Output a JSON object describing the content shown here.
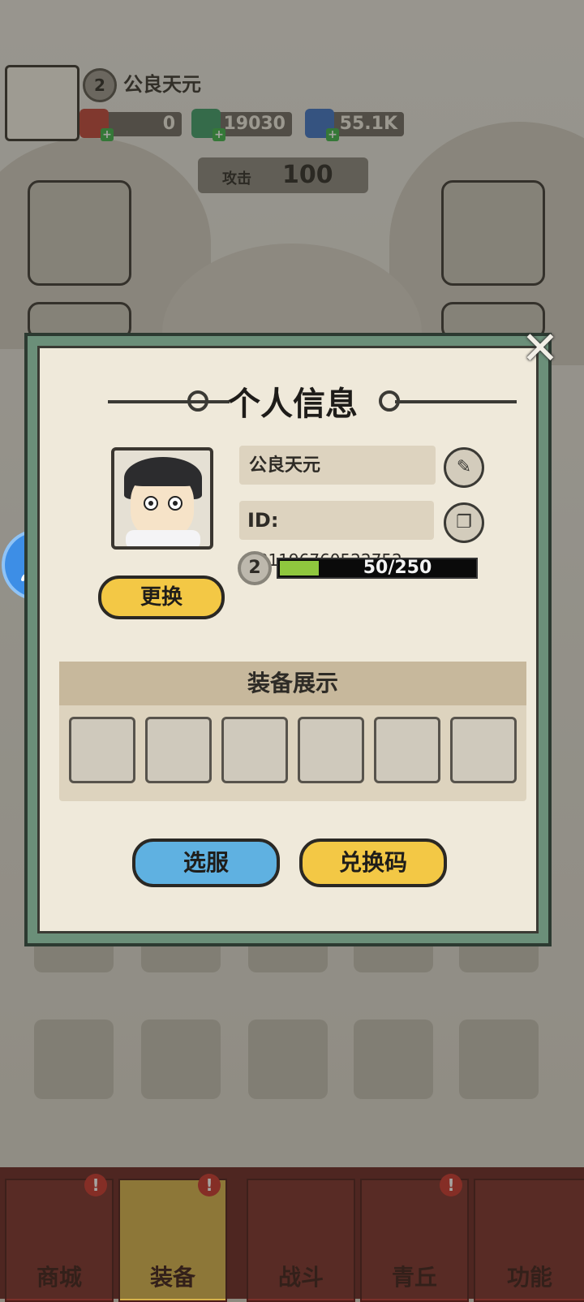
{
  "hud": {
    "player_name": "公良天元",
    "level": "2",
    "resources": [
      {
        "name": "red-gift",
        "value": "0",
        "color": "#c0463a"
      },
      {
        "name": "jade-dragon",
        "value": "19030",
        "color": "#3e9e6a"
      },
      {
        "name": "blue-crystal",
        "value": "55.1K",
        "color": "#3f74c6"
      }
    ],
    "attack_label": "攻击",
    "attack_value": "100"
  },
  "dialog": {
    "title": "个人信息",
    "name": "公良天元",
    "id_label": "ID:",
    "id_value": "381196760522752",
    "level": "2",
    "exp_text": "50/250",
    "exp_progress": 0.2,
    "change_button": "更换",
    "equip_title": "装备展示",
    "equip_slots": 6,
    "server_button": "选服",
    "code_button": "兑换码",
    "close_glyph": "✕",
    "edit_icon": "pencil-icon",
    "copy_icon": "copy-icon"
  },
  "nav": {
    "tabs": [
      {
        "label": "商城",
        "alert": "!"
      },
      {
        "label": "装备",
        "alert": "!"
      },
      {
        "label": "战斗",
        "alert": ""
      },
      {
        "label": "青丘",
        "alert": "!"
      },
      {
        "label": "功能",
        "alert": ""
      }
    ],
    "active_index": 1
  },
  "colors": {
    "dialog_frame": "#6b8f79",
    "paper": "#efe9da",
    "yellow_button": "#f3c845",
    "blue_button": "#5fb1e1",
    "exp_fill": "#8fc73e"
  }
}
